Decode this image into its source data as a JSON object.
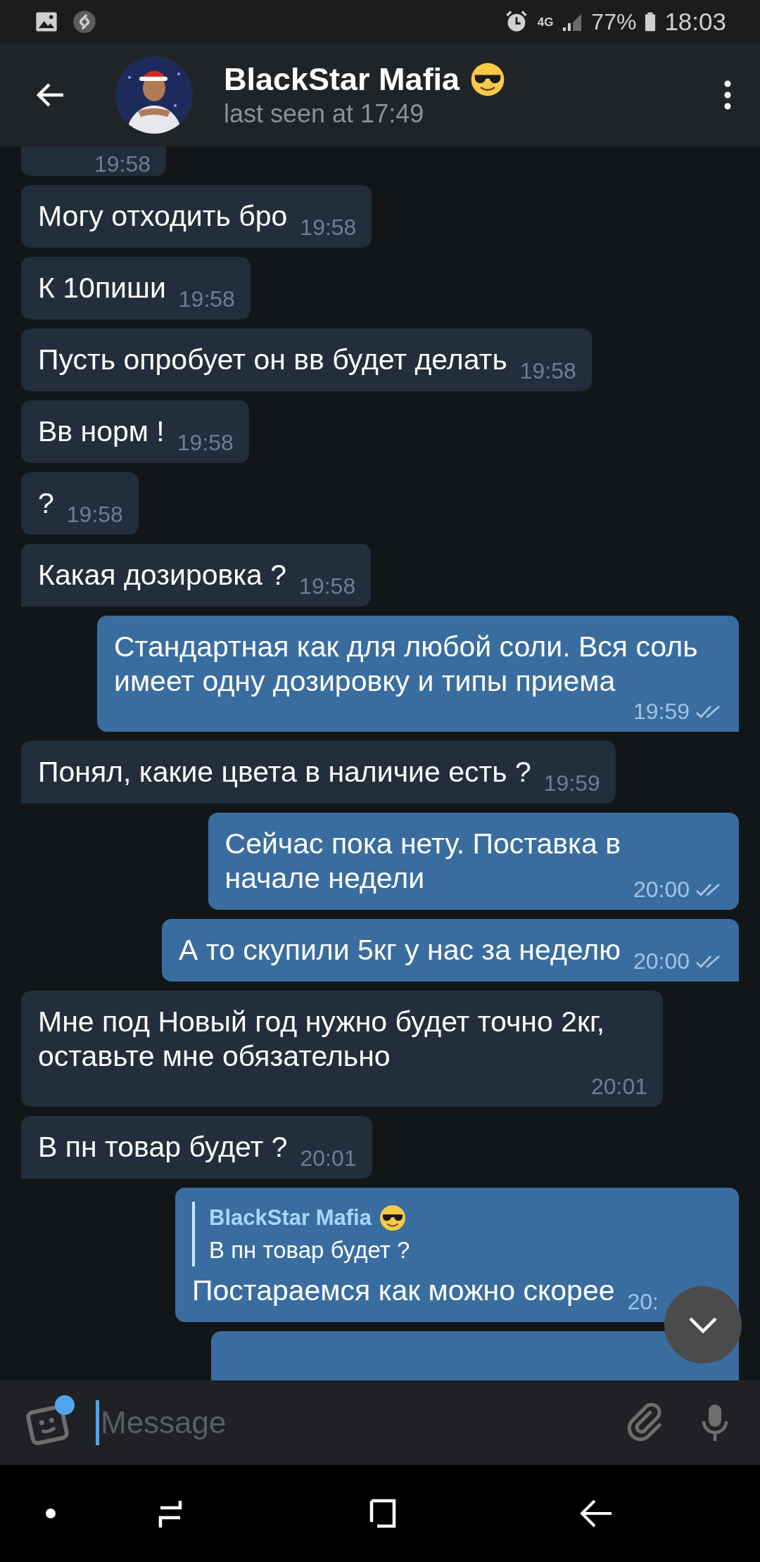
{
  "status_bar": {
    "network": "4G",
    "battery": "77%",
    "time": "18:03"
  },
  "header": {
    "title": "BlackStar Mafia",
    "subtitle": "last seen at 17:49"
  },
  "messages": [
    {
      "kind": "incoming",
      "time": "19:58",
      "tail": false
    },
    {
      "kind": "incoming",
      "text": "Могу отходить бро",
      "time": "19:58",
      "tail": false
    },
    {
      "kind": "incoming",
      "text": "К 10пиши",
      "time": "19:58",
      "tail": false
    },
    {
      "kind": "incoming",
      "text": "Пусть опробует он вв будет делать",
      "time": "19:58",
      "tail": false
    },
    {
      "kind": "incoming",
      "text": "Вв норм !",
      "time": "19:58",
      "tail": false
    },
    {
      "kind": "incoming",
      "text": "?",
      "time": "19:58",
      "tail": false
    },
    {
      "kind": "incoming",
      "text": "Какая дозировка ?",
      "time": "19:58",
      "tail": true
    },
    {
      "kind": "outgoing",
      "text": "Стандартная как для любой соли. Вся соль имеет одну дозировку и типы приема",
      "time": "19:59",
      "read": true,
      "tail": true
    },
    {
      "kind": "incoming",
      "text": "Понял, какие цвета в наличие есть ?",
      "time": "19:59",
      "tail": true
    },
    {
      "kind": "outgoing",
      "text": "Сейчас пока нету. Поставка в\nначале недели",
      "time": "20:00",
      "read": true,
      "tail": false
    },
    {
      "kind": "outgoing",
      "text": "А то скупили 5кг у нас за неделю",
      "time": "20:00",
      "read": true,
      "tail": true
    },
    {
      "kind": "incoming",
      "text": "Мне под Новый год нужно будет точно 2кг, оставьте мне обязательно",
      "time": "20:01",
      "tail": false
    },
    {
      "kind": "incoming",
      "text": "В пн товар будет ?",
      "time": "20:01",
      "tail": true
    },
    {
      "kind": "outgoing",
      "reply": {
        "name": "BlackStar Mafia",
        "text": "В пн товар будет ?"
      },
      "text": "Постараемся как можно скорее",
      "time": "20:"
    },
    {
      "kind": "outgoing"
    }
  ],
  "composer": {
    "placeholder": "Message",
    "sticker_badge": true
  }
}
